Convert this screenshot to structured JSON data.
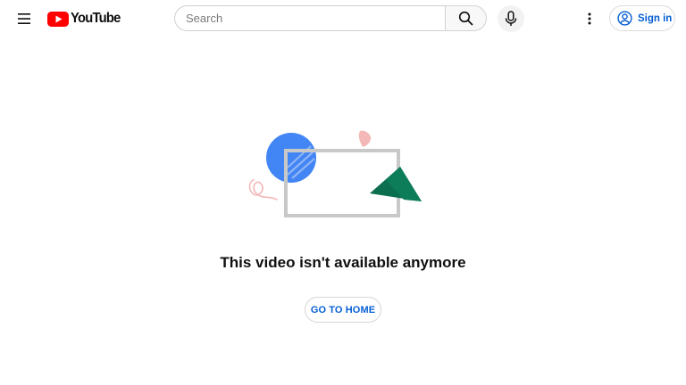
{
  "header": {
    "menu_icon": "hamburger-menu-icon",
    "logo_text": "YouTube",
    "search": {
      "placeholder": "Search",
      "value": ""
    },
    "search_icon": "search-icon",
    "mic_icon": "microphone-icon",
    "more_icon": "vertical-dots-icon",
    "signin_label": "Sign in",
    "signin_icon": "account-circle-icon"
  },
  "main": {
    "illustration": "broken-video-illustration",
    "message": "This video isn't available anymore",
    "home_button_label": "GO TO HOME"
  },
  "colors": {
    "brand_red": "#ff0000",
    "link_blue": "#065fd4",
    "text": "#0f0f0f",
    "illustration_blue": "#4285f4",
    "illustration_green": "#0b6e4f",
    "illustration_pink": "#f4b8b8",
    "illustration_frame": "#c8c8c8"
  }
}
